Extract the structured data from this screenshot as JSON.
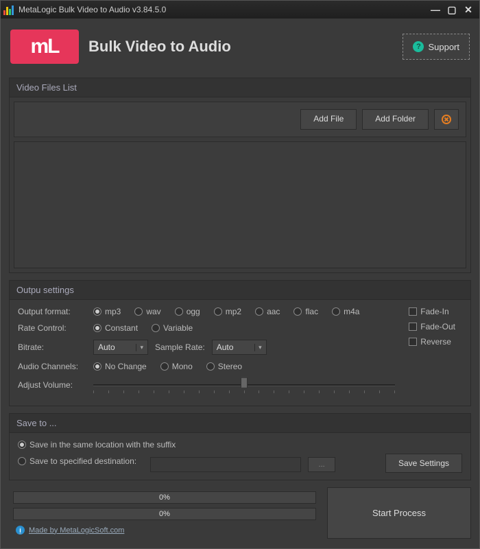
{
  "window": {
    "title": "MetaLogic Bulk Video to Audio v3.84.5.0"
  },
  "header": {
    "app_title": "Bulk Video to Audio",
    "logo_text": "mL",
    "support_label": "Support"
  },
  "file_list": {
    "group_title": "Video Files List",
    "add_file_label": "Add File",
    "add_folder_label": "Add Folder"
  },
  "output": {
    "group_title": "Outpu settings",
    "format_label": "Output format:",
    "formats": [
      "mp3",
      "wav",
      "ogg",
      "mp2",
      "aac",
      "flac",
      "m4a"
    ],
    "format_selected": "mp3",
    "rate_control_label": "Rate Control:",
    "rate_options": [
      "Constant",
      "Variable"
    ],
    "rate_selected": "Constant",
    "bitrate_label": "Bitrate:",
    "bitrate_value": "Auto",
    "sample_rate_label": "Sample Rate:",
    "sample_rate_value": "Auto",
    "channels_label": "Audio Channels:",
    "channel_options": [
      "No Change",
      "Mono",
      "Stereo"
    ],
    "channel_selected": "No Change",
    "volume_label": "Adjust Volume:",
    "fade_in_label": "Fade-In",
    "fade_out_label": "Fade-Out",
    "reverse_label": "Reverse"
  },
  "saveto": {
    "group_title": "Save to ...",
    "same_location_label": "Save in the same location with the suffix",
    "specified_label": "Save to specified destination:",
    "browse_label": "...",
    "selected": "same",
    "save_settings_label": "Save Settings"
  },
  "progress": {
    "bar1": "0%",
    "bar2": "0%",
    "start_label": "Start Process"
  },
  "footer": {
    "made_by": "Made by MetaLogicSoft.com"
  }
}
